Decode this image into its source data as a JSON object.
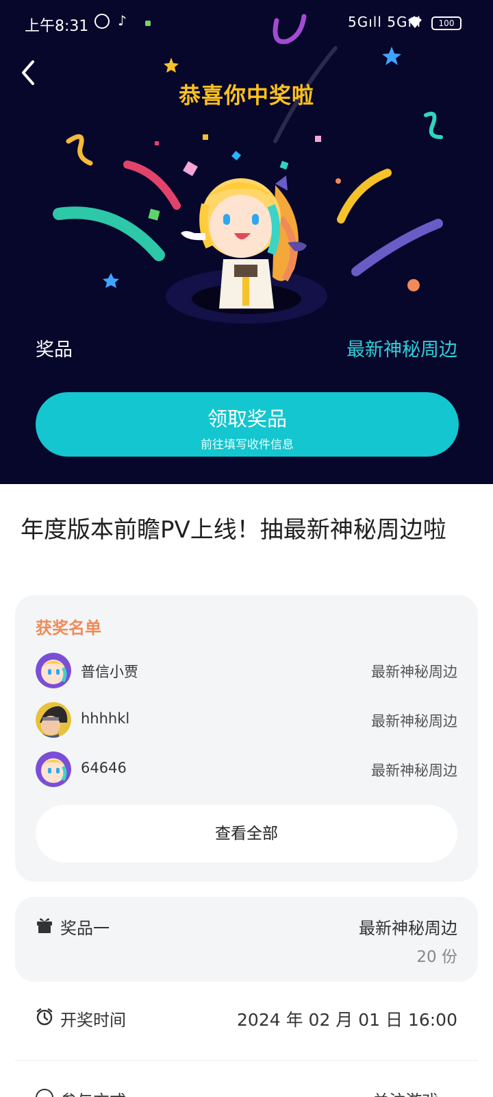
{
  "status_bar": {
    "time": "上午8:31",
    "alarm_icon": "alarm-icon",
    "app_icon": "tiktok-icon",
    "signal": "5Gıll 5Gıll",
    "wifi_icon": "wifi-icon",
    "battery": "100"
  },
  "hero": {
    "back_icon": "chevron-left-icon",
    "congrats": "恭喜你中奖啦",
    "prize_label": "奖品",
    "prize_value": "最新神秘周边",
    "claim_button": {
      "title": "领取奖品",
      "subtitle": "前往填写收件信息"
    },
    "colors": {
      "background": "#07062b",
      "title": "#ffc21a",
      "accent": "#13c6cf",
      "prize_value": "#2fcfd8"
    }
  },
  "event": {
    "title": "年度版本前瞻PV上线！抽最新神秘周边啦"
  },
  "winners": {
    "heading": "获奖名单",
    "list": [
      {
        "name": "普信小贾",
        "prize": "最新神秘周边",
        "avatar": "mascot-avatar"
      },
      {
        "name": "hhhhkl",
        "prize": "最新神秘周边",
        "avatar": "anime-character-avatar"
      },
      {
        "name": "64646",
        "prize": "最新神秘周边",
        "avatar": "mascot-avatar"
      }
    ],
    "view_all": "查看全部"
  },
  "prize_info": {
    "icon": "gift-icon",
    "tier": "奖品一",
    "name": "最新神秘周边",
    "quantity": "20 份"
  },
  "draw": {
    "icon": "clock-icon",
    "label": "开奖时间",
    "value": "2024 年 02 月 01 日 16:00"
  },
  "participation": {
    "label": "参与方式",
    "value": "关注游戏 >"
  }
}
